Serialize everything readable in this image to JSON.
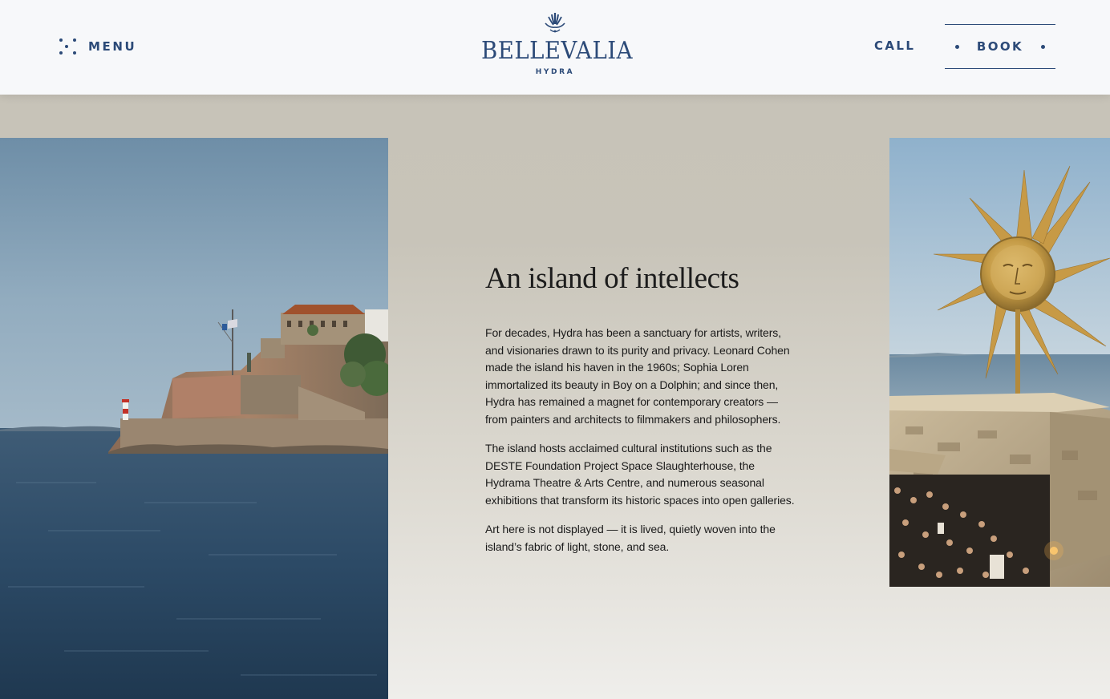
{
  "header": {
    "menu_label": "MENU",
    "logo_name": "BELLEVALIA",
    "logo_sub": "HYDRA",
    "call_label": "CALL",
    "book_label": "BOOK"
  },
  "content": {
    "heading": "An island of intellects",
    "paragraphs": [
      "For decades, Hydra has been a sanctuary for artists, writers, and visionaries drawn to its purity and privacy. Leonard Cohen made the island his haven in the 1960s; Sophia Loren immortalized its beauty in Boy on a Dolphin; and since then, Hydra has remained a magnet for contemporary creators — from painters and architects to filmmakers and philosophers.",
      "The island hosts acclaimed cultural institutions such as the DESTE Foundation Project Space Slaughterhouse, the Hydrama Theatre & Arts Centre, and numerous seasonal exhibitions that transform its historic spaces into open galleries.",
      "Art here is not displayed — it is lived, quietly woven into the island’s fabric of light, stone, and sea."
    ]
  },
  "icons": {
    "menu": "dots-menu-icon",
    "logo_crest": "crest-icon"
  },
  "colors": {
    "brand": "#2c4a78",
    "header_bg": "#f7f8fa",
    "page_bg": "#c6c2b7"
  }
}
